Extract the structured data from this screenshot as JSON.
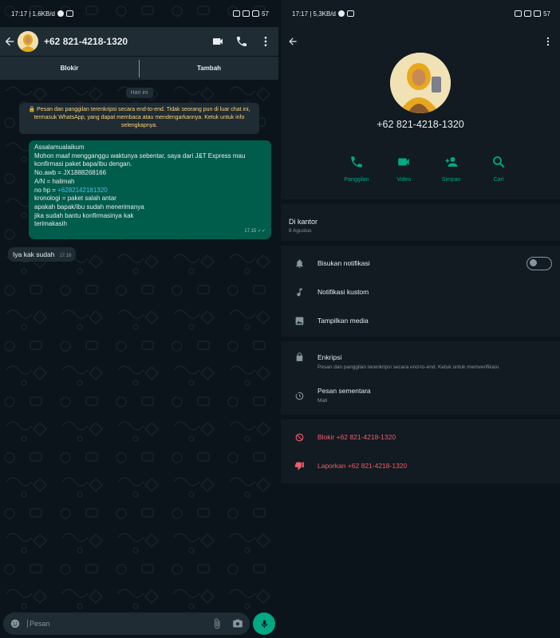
{
  "left": {
    "status": {
      "time_net": "17:17 | 1,6KB/d",
      "battery": "57"
    },
    "header": {
      "contact": "+62 821-4218-1320"
    },
    "bar": {
      "block": "Blokir",
      "add": "Tambah"
    },
    "day_chip": "Hari ini",
    "e2e_notice": "Pesan dan panggilan terenkripsi secara end-to-end. Tidak seorang pun di luar chat ini, termasuk WhatsApp, yang dapat membaca atau mendengarkannya. Ketuk untuk info selengkapnya.",
    "outgoing": {
      "lines": [
        "Assalamualaikum",
        "Mohon maaf mengganggu waktunya sebentar, saya dari J&T Express mau",
        "konfirmasi paket bapa/ibu dengan.",
        "No.awb = JX1888268166",
        "A/N = halimah"
      ],
      "phone_prefix": "no hp = ",
      "phone_link": "+6282142181320",
      "lines2": [
        "kronologi = paket salah antar",
        "apakah bapak/ibu sudah menerimanya",
        "jika sudah bantu konfirmasinya kak",
        "terimakasih"
      ],
      "time": "17.15"
    },
    "incoming": {
      "text": "Iya kak sudah",
      "time": "17.16"
    },
    "composer": {
      "placeholder": "Pesan"
    }
  },
  "right": {
    "status": {
      "time_net": "17:17 | 5,3KB/d",
      "battery": "57"
    },
    "name": "+62 821-4218-1320",
    "actions": [
      {
        "label": "Panggilan",
        "icon": "phone-icon"
      },
      {
        "label": "Video",
        "icon": "video-icon"
      },
      {
        "label": "Simpan",
        "icon": "add-contact-icon"
      },
      {
        "label": "Cari",
        "icon": "search-icon"
      }
    ],
    "about": {
      "title": "Di kantor",
      "date": "8 Agustus"
    },
    "settings": {
      "mute": "Bisukan notifikasi",
      "custom": "Notifikasi kustom",
      "media": "Tampilkan media"
    },
    "privacy": {
      "encryption_title": "Enkripsi",
      "encryption_sub": "Pesan dan panggilan terenkripsi secara end-to-end. Ketuk untuk memverifikasi.",
      "disappearing_title": "Pesan sementara",
      "disappearing_sub": "Mati"
    },
    "danger": {
      "block": "Blokir +62 821-4218-1320",
      "report": "Laporkan +62 821-4218-1320"
    }
  },
  "colors": {
    "accent": "#00a884",
    "danger": "#f15c6d",
    "bubble_out": "#005c4b",
    "panel": "#111b21"
  }
}
